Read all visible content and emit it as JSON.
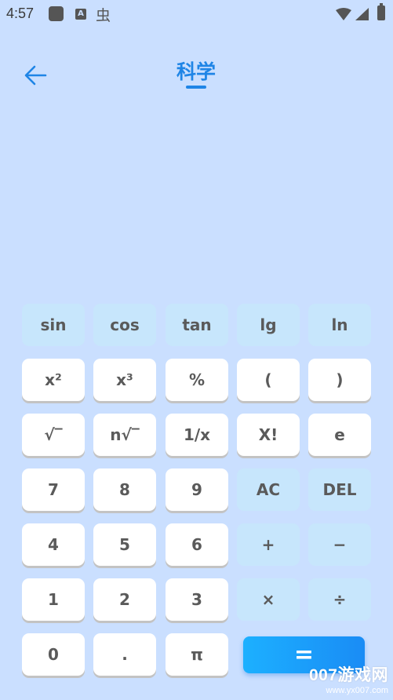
{
  "status_bar": {
    "time": "4:57",
    "icons": [
      "app-square-icon",
      "a-notification-icon",
      "bug-icon",
      "wifi-icon",
      "signal-icon",
      "battery-icon"
    ]
  },
  "header": {
    "back_icon": "arrow-left-icon",
    "title": "科学"
  },
  "colors": {
    "background": "#cadfff",
    "accent": "#1f85e6",
    "function_key": "#c7e6fc",
    "number_key": "#ffffff",
    "key_text": "#5a5a5a"
  },
  "keypad": {
    "rows": [
      [
        "sin",
        "cos",
        "tan",
        "lg",
        "ln"
      ],
      [
        "x²",
        "x³",
        "%",
        "(",
        ")"
      ],
      [
        "√‾",
        "n√‾",
        "1/x",
        "X!",
        "e"
      ],
      [
        "7",
        "8",
        "9",
        "AC",
        "DEL"
      ],
      [
        "4",
        "5",
        "6",
        "+",
        "−"
      ],
      [
        "1",
        "2",
        "3",
        "×",
        "÷"
      ],
      [
        "0",
        ".",
        "π",
        "="
      ]
    ]
  },
  "watermark": {
    "main": "007游戏网",
    "sub": "www.yx007.com"
  }
}
